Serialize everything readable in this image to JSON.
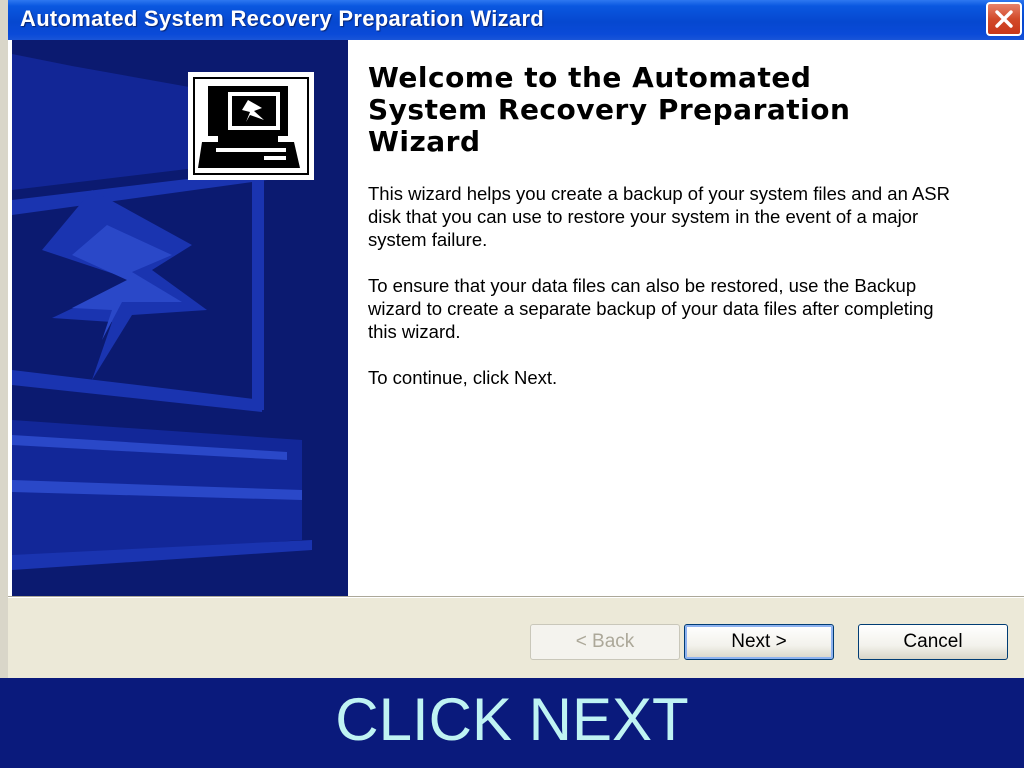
{
  "window": {
    "title": "Automated System Recovery Preparation Wizard"
  },
  "sidebar": {
    "logo_icon": "computer-lightning-icon"
  },
  "main": {
    "heading": "Welcome to the Automated System Recovery Preparation Wizard",
    "paragraphs": [
      "This wizard helps you create a backup of your system files and an ASR disk that you can use to restore your system in the event of a major system failure.",
      "To ensure that your data files can also be restored, use the Backup wizard to create a separate backup of your data files after completing this wizard.",
      "To continue, click Next."
    ]
  },
  "buttons": {
    "back": "< Back",
    "next": "Next >",
    "cancel": "Cancel"
  },
  "banner": {
    "text": "CLICK NEXT"
  },
  "colors": {
    "titlebar": "#0648d0",
    "sidebar": "#0b1a70",
    "banner": "#0a1a7c",
    "banner_text": "#bff3f3"
  }
}
